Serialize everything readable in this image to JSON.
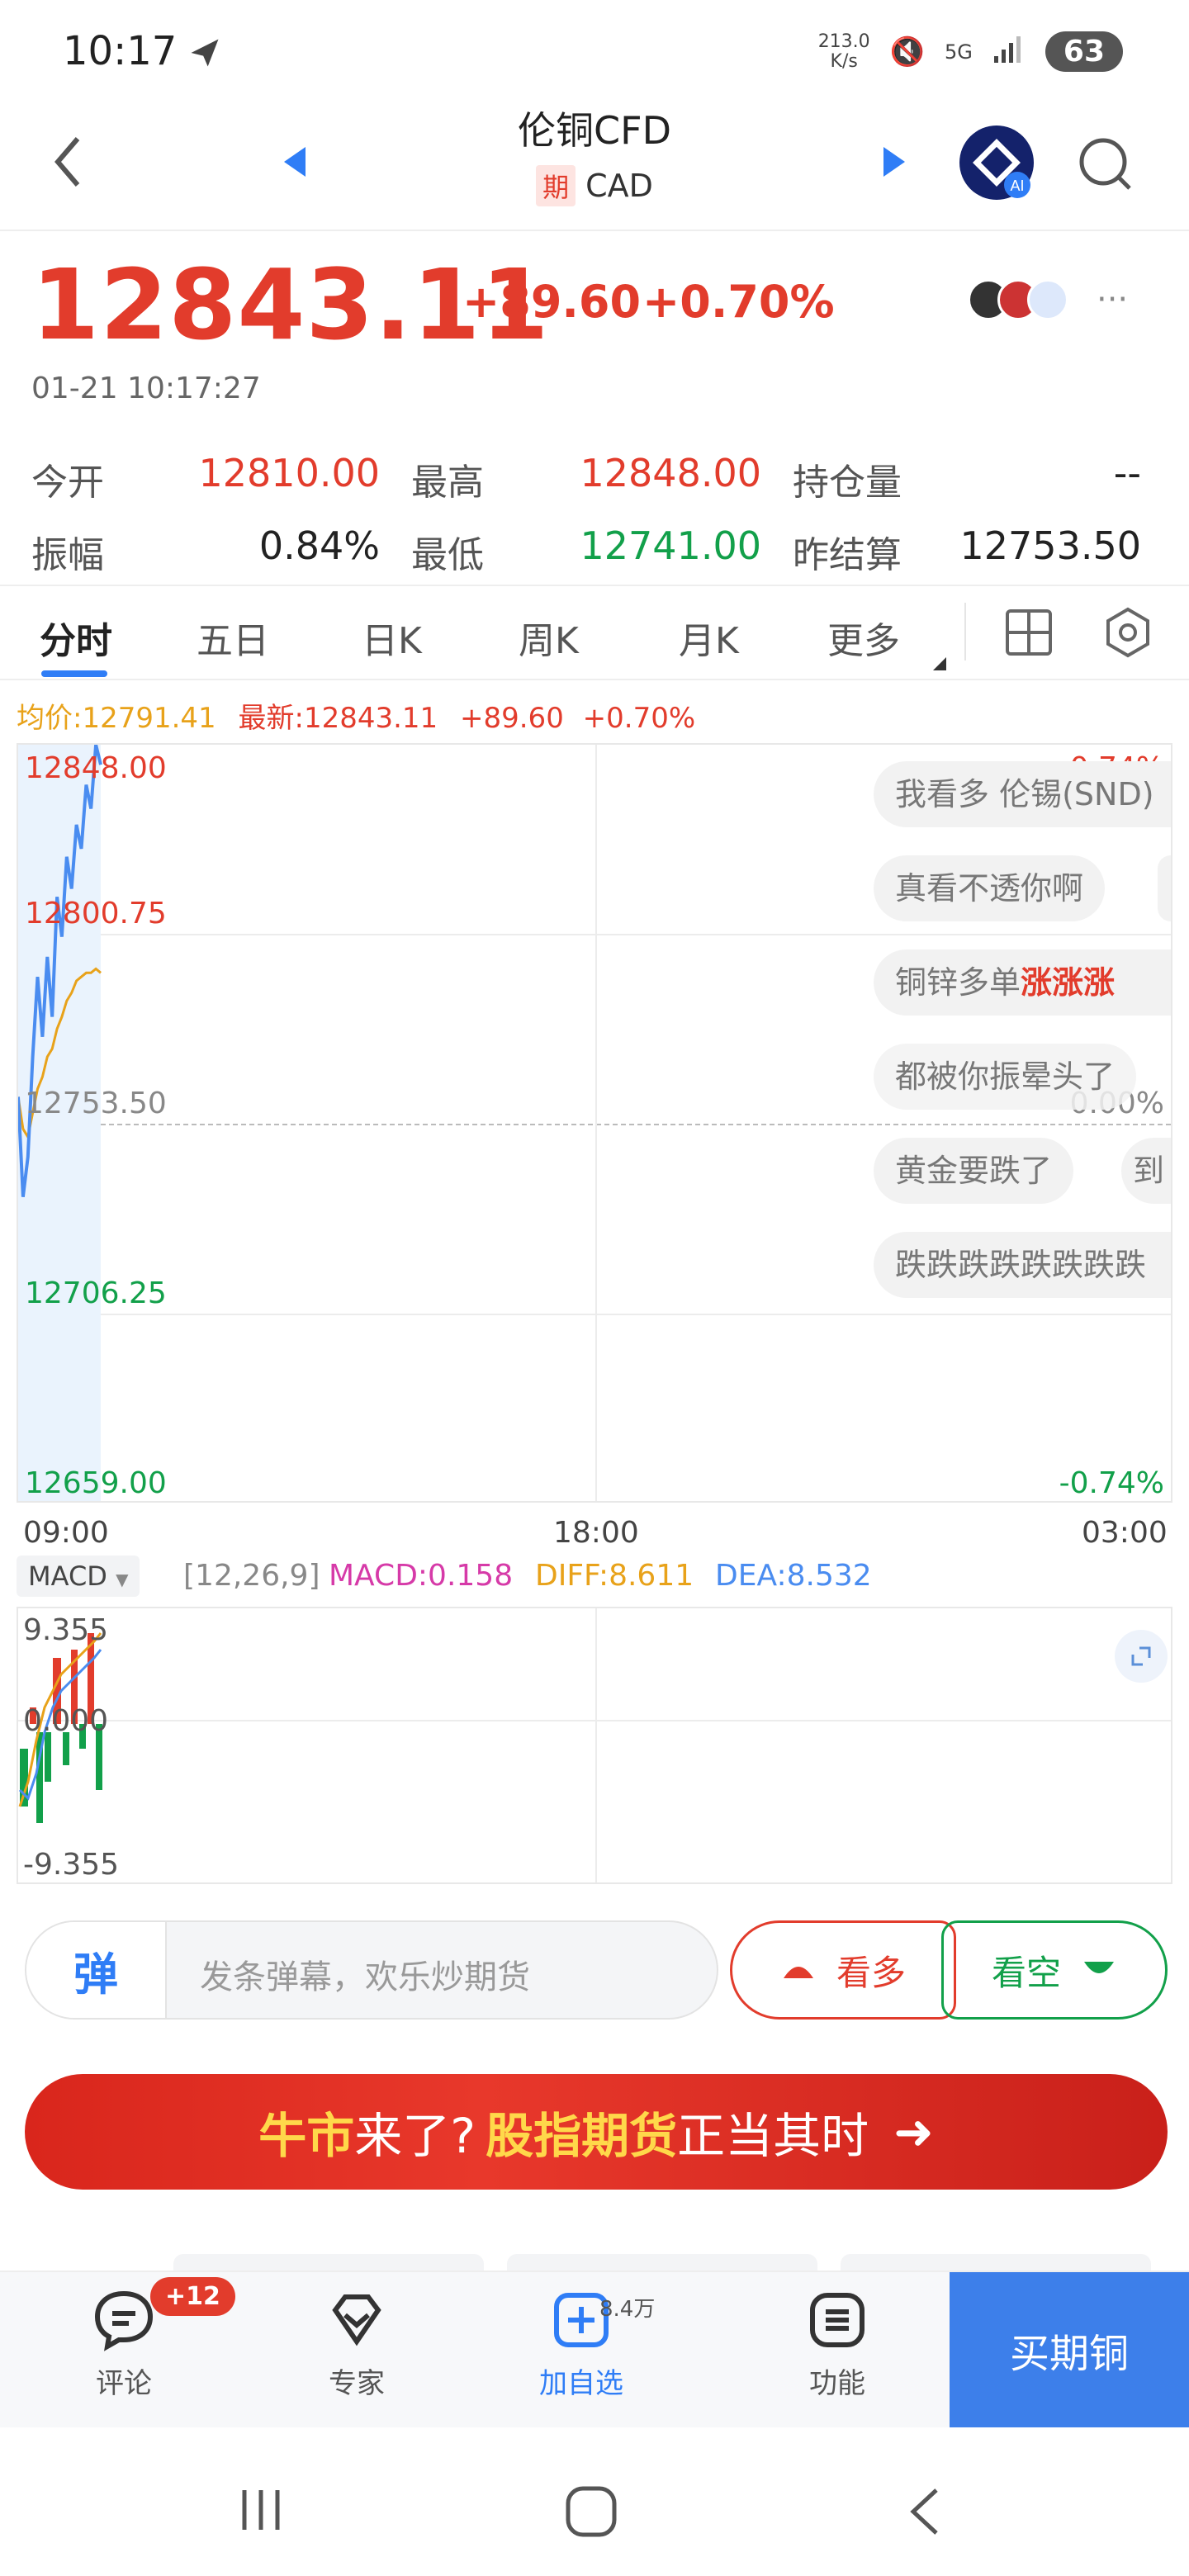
{
  "status": {
    "time": "10:17",
    "net_speed": "213.0\nK/s",
    "net_type": "5G",
    "battery": "63"
  },
  "header": {
    "title": "伦铜CFD",
    "badge": "期",
    "subtitle": "CAD"
  },
  "price": {
    "last": "12843.11",
    "change": "+89.60",
    "change_pct": "+0.70%",
    "time": "01-21 10:17:27"
  },
  "quote": {
    "open_label": "今开",
    "open": "12810.00",
    "high_label": "最高",
    "high": "12848.00",
    "oi_label": "持仓量",
    "oi": "--",
    "amp_label": "振幅",
    "amp": "0.84%",
    "low_label": "最低",
    "low": "12741.00",
    "settle_label": "昨结算",
    "settle": "12753.50"
  },
  "tabs": [
    "分时",
    "五日",
    "日K",
    "周K",
    "月K",
    "更多"
  ],
  "chart_info": {
    "avg": "均价:12791.41",
    "latest": "最新:12843.11",
    "change": "+89.60",
    "pct": "+0.70%"
  },
  "chart_data": {
    "type": "line",
    "y_labels": [
      "12848.00",
      "12800.75",
      "12753.50",
      "12706.25",
      "12659.00"
    ],
    "pct_labels": [
      "0.74%",
      "0.00%",
      "-0.74%"
    ],
    "x_labels": [
      "09:00",
      "18:00",
      "03:00"
    ],
    "ylim": [
      12659.0,
      12848.0
    ],
    "price": [
      12760,
      12735,
      12745,
      12770,
      12790,
      12775,
      12795,
      12780,
      12810,
      12800,
      12820,
      12812,
      12828,
      12822,
      12838,
      12832,
      12848,
      12843
    ],
    "avg": [
      12760,
      12752,
      12750,
      12756,
      12762,
      12765,
      12770,
      12772,
      12777,
      12780,
      12784,
      12786,
      12789,
      12790,
      12791,
      12791,
      12792,
      12791
    ]
  },
  "danmu": [
    "我看多 伦锡(SND)",
    "真看不透你啊",
    "铜锌多单",
    "涨涨涨",
    "都被你振晕头了",
    "黄金要跌了",
    "到",
    "跌跌跌跌跌跌跌跌"
  ],
  "macd": {
    "selector": "MACD",
    "params": "[12,26,9]",
    "macd": "MACD:0.158",
    "diff": "DIFF:8.611",
    "dea": "DEA:8.532",
    "y_top": "9.355",
    "y_mid": "0.000",
    "y_bot": "-9.355"
  },
  "input": {
    "icon_text": "弹",
    "placeholder": "发条弹幕，欢乐炒期货"
  },
  "buttons": {
    "long": "看多",
    "short": "看空"
  },
  "banner": {
    "part1": "牛市",
    "part2": "来了?",
    "part3": "股指期货",
    "part4": "正当其时"
  },
  "bottom": {
    "comment": "评论",
    "comment_badge": "+12",
    "expert": "专家",
    "add": "加自选",
    "add_count": "8.4万",
    "func": "功能",
    "buy": "买期铜"
  }
}
